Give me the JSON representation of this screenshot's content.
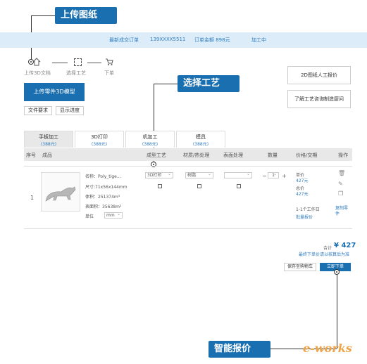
{
  "callouts": {
    "upload": "上传图纸",
    "process": "选择工艺",
    "quote": "智能报价"
  },
  "topbar": {
    "item1": "最新成交订单",
    "item2": "139XXXX5511",
    "item3": "订单金额 898元",
    "item4": "加工中"
  },
  "steps": {
    "step1": "上传3D文档",
    "step2": "选择工艺",
    "step3": "下单"
  },
  "upload_button": "上传零件3D模型",
  "buttons": {
    "file_req": "文件要求",
    "progress": "显示进度"
  },
  "side": {
    "manual_quote": "2D图纸人工报价",
    "consult": "了解工艺咨询制造厨问"
  },
  "tabs": [
    {
      "label": "手板加工",
      "price": "(388元)"
    },
    {
      "label": "3D打印",
      "price": "(388元)"
    },
    {
      "label": "机加工",
      "price": "(388元)"
    },
    {
      "label": "模具",
      "price": "(388元)"
    }
  ],
  "table_headers": {
    "index": "序号",
    "part": "成品",
    "process": "成型工艺",
    "material": "材质/热处理",
    "surface": "表面处理",
    "qty": "数量",
    "price": "价格/交期",
    "action": "操作"
  },
  "row": {
    "index": "1",
    "name": "名称：Poly_tige...",
    "size": "尺寸:71x56x144mm",
    "volume": "体积：251374m³",
    "area": "表面积：35638m²",
    "unit_label": "单位",
    "unit": "mm",
    "process": "3D打印",
    "material": "树脂",
    "surface": "",
    "qty": "1",
    "unit_price_label": "单价",
    "unit_price": "427元",
    "total_label": "总价",
    "total": "427元",
    "delivery": "1-1个工作日",
    "delivery_link": "批量报价",
    "action_link": "复制零件"
  },
  "summary": {
    "total_label": "合计",
    "total": "¥ 427",
    "note": "最终下单价请以核算后为准"
  },
  "footer_buttons": {
    "save": "保存至购物车",
    "order": "立即下单"
  },
  "watermark": "e-works"
}
